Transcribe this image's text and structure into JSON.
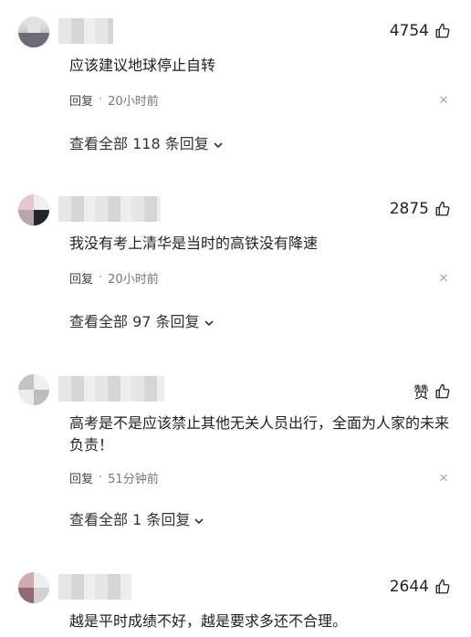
{
  "comments": [
    {
      "likes": "4754",
      "text": "应该建议地球停止自转",
      "reply_label": "回复",
      "time": "20小时前",
      "view_replies": "查看全部 118 条回复"
    },
    {
      "likes": "2875",
      "text": "我没有考上清华是当时的高铁没有降速",
      "reply_label": "回复",
      "time": "20小时前",
      "view_replies": "查看全部 97 条回复"
    },
    {
      "likes": "赞",
      "text": "高考是不是应该禁止其他无关人员出行，全面为人家的未来负责！",
      "reply_label": "回复",
      "time": "51分钟前",
      "view_replies": "查看全部 1 条回复"
    },
    {
      "likes": "2644",
      "text": "越是平时成绩不好，越是要求多还不合理。"
    }
  ],
  "icons": {
    "like": "thumbs-up-icon",
    "close": "close-icon",
    "expand": "chevron-down-icon"
  },
  "colors": {
    "text": "#222222",
    "meta": "#777777",
    "icon_muted": "#aaaaaa"
  }
}
